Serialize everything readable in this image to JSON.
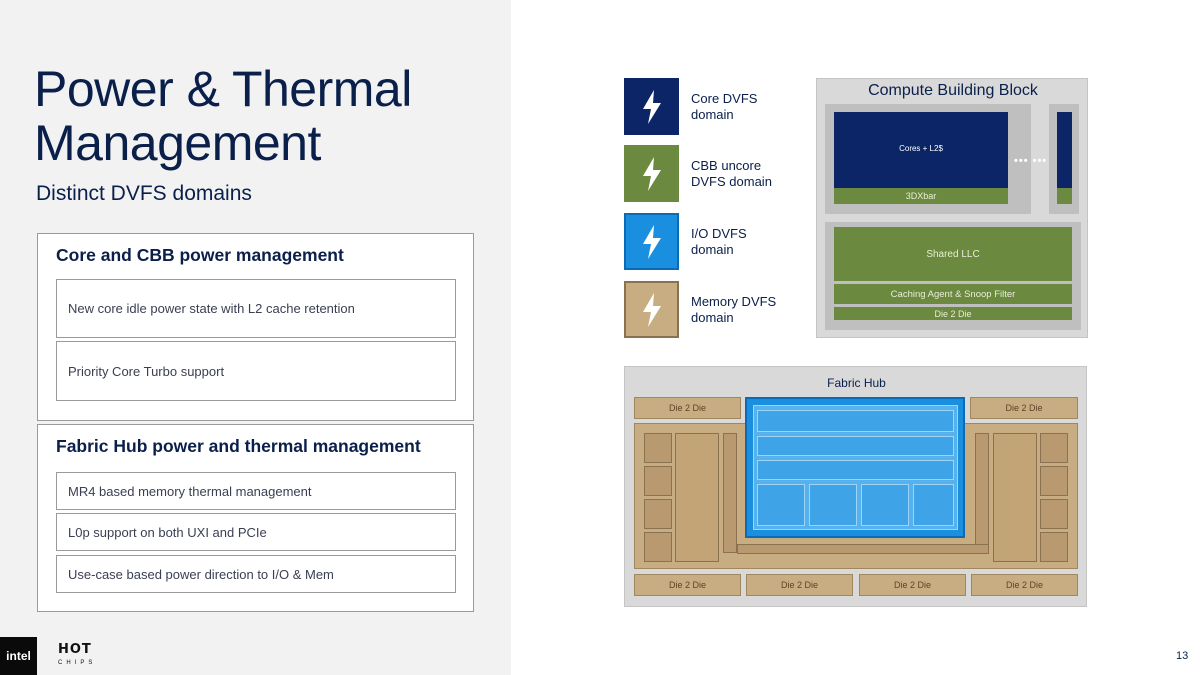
{
  "slide": {
    "title_line1": "Power & Thermal",
    "title_line2": "Management",
    "subtitle": "Distinct DVFS domains",
    "page_number": "13"
  },
  "sections": [
    {
      "heading": "Core and CBB power management",
      "items": [
        "New core idle power state with L2 cache retention",
        "Priority Core Turbo support"
      ]
    },
    {
      "heading": "Fabric Hub power and thermal management",
      "items": [
        "MR4 based memory thermal management",
        "L0p support on both UXI and PCIe",
        "Use-case based power direction to I/O & Mem"
      ]
    }
  ],
  "legend": [
    {
      "label_line1": "Core DVFS",
      "label_line2": "domain",
      "color": "#0b2566"
    },
    {
      "label_line1": "CBB uncore",
      "label_line2": "DVFS domain",
      "color": "#6b8a3f"
    },
    {
      "label_line1": "I/O DVFS",
      "label_line2": "domain",
      "color": "#1a8fe0"
    },
    {
      "label_line1": "Memory DVFS",
      "label_line2": "domain",
      "color": "#c9ad82"
    }
  ],
  "cbb": {
    "title": "Compute Building Block",
    "cores_label": "Cores + L2$",
    "xbar_label": "3DXbar",
    "dots": "••• •••",
    "llc_label": "Shared LLC",
    "caching_label": "Caching Agent & Snoop Filter",
    "d2d_label": "Die 2 Die"
  },
  "fabric_hub": {
    "title": "Fabric Hub",
    "d2d_top_left": "Die 2 Die",
    "d2d_top_right": "Die 2 Die",
    "d2d_bottom": [
      "Die 2 Die",
      "Die 2 Die",
      "Die 2 Die",
      "Die 2 Die"
    ]
  },
  "logos": {
    "intel": "intel",
    "hotchips_top": "HOT",
    "hotchips_bottom": "CHIPS"
  }
}
